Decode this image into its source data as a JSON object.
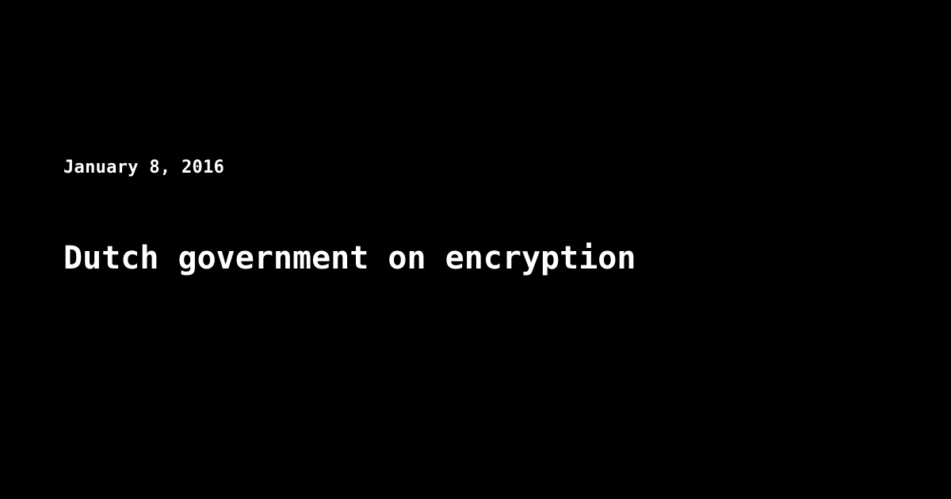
{
  "post": {
    "date": "January 8, 2016",
    "title": "Dutch government on encryption"
  },
  "colors": {
    "background": "#000000",
    "text": "#ffffff"
  }
}
